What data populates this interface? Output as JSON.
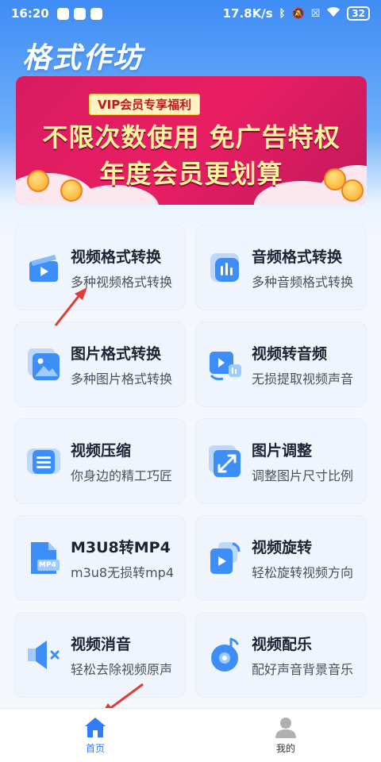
{
  "status_bar": {
    "time": "16:20",
    "network_speed": "17.8K/s",
    "battery": "32",
    "icons": [
      "bluetooth-icon",
      "mute-icon",
      "no-sim-icon",
      "wifi-icon"
    ]
  },
  "app": {
    "title": "格式作坊"
  },
  "banner": {
    "tag": "VIP会员专享福利",
    "line1": "不限次数使用 免广告特权",
    "line2": "年度会员更划算",
    "colors": {
      "background": "#e91e63",
      "text": "#fff59d"
    }
  },
  "features": [
    {
      "title": "视频格式转换",
      "subtitle": "多种视频格式转换",
      "icon": "video-convert-icon"
    },
    {
      "title": "音频格式转换",
      "subtitle": "多种音频格式转换",
      "icon": "audio-convert-icon"
    },
    {
      "title": "图片格式转换",
      "subtitle": "多种图片格式转换",
      "icon": "image-convert-icon"
    },
    {
      "title": "视频转音频",
      "subtitle": "无损提取视频声音",
      "icon": "video-to-audio-icon"
    },
    {
      "title": "视频压缩",
      "subtitle": "你身边的精工巧匠",
      "icon": "video-compress-icon"
    },
    {
      "title": "图片调整",
      "subtitle": "调整图片尺寸比例",
      "icon": "image-resize-icon"
    },
    {
      "title": "M3U8转MP4",
      "subtitle": "m3u8无损转mp4",
      "icon": "m3u8-file-icon",
      "badge": "MP4"
    },
    {
      "title": "视频旋转",
      "subtitle": "轻松旋转视频方向",
      "icon": "video-rotate-icon"
    },
    {
      "title": "视频消音",
      "subtitle": "轻松去除视频原声",
      "icon": "video-mute-icon"
    },
    {
      "title": "视频配乐",
      "subtitle": "配好声音背景音乐",
      "icon": "video-music-icon"
    }
  ],
  "tabs": [
    {
      "label": "首页",
      "icon": "home-icon",
      "active": true
    },
    {
      "label": "我的",
      "icon": "profile-icon",
      "active": false
    }
  ],
  "theme": {
    "accent": "#2f7cf6",
    "arrow": "#e53935"
  }
}
